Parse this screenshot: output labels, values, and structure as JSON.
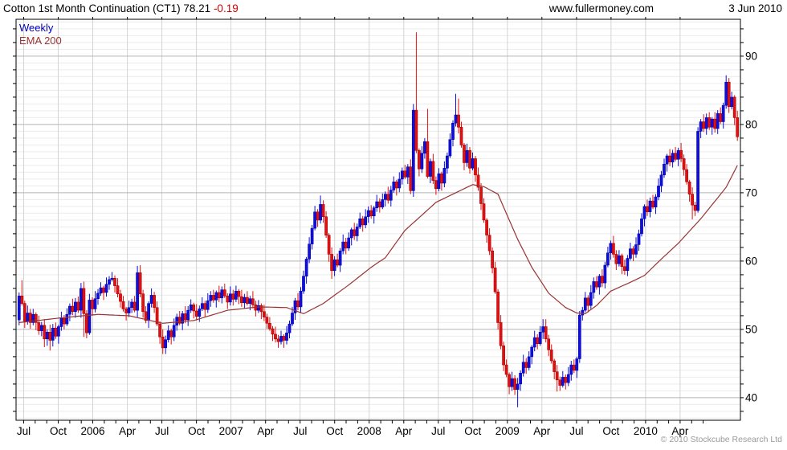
{
  "header": {
    "title_main": "Cotton 1st Month Continuation (CT1)",
    "last_price": "78.21",
    "change": "-0.19",
    "site": "www.fullermoney.com",
    "date": "3 Jun 2010"
  },
  "legend": {
    "series_label": "Weekly",
    "overlay_label": "EMA 200"
  },
  "footer": {
    "copyright": "© 2010 Stockcube Research Ltd"
  },
  "colors": {
    "up": "#0e0ee0",
    "up_stroke": "#000099",
    "down": "#e41010",
    "down_stroke": "#990000",
    "ema": "#993333",
    "grid_minor": "#ececec",
    "grid_major": "#b4b4b4",
    "grid_vert": "#d4d4d4",
    "axis": "#000000",
    "change_neg": "#cc0000",
    "copyright": "#9a9a9a"
  },
  "chart_data": {
    "type": "candlestick",
    "title": "Cotton 1st Month Continuation (CT1)",
    "interval": "Weekly",
    "overlay": "EMA 200",
    "start": "Jul 2005",
    "end": "Jun 2010",
    "ylim": [
      36.7,
      95.4
    ],
    "y_tick_labels": [
      40,
      50,
      60,
      70,
      80,
      90
    ],
    "y_minor_step": 1,
    "y_tick_step": 2,
    "months_total": 59,
    "x_ticks": [
      {
        "m": 0,
        "label": "Jul"
      },
      {
        "m": 3,
        "label": "Oct"
      },
      {
        "m": 6,
        "label": "2006"
      },
      {
        "m": 9,
        "label": "Apr"
      },
      {
        "m": 12,
        "label": "Jul"
      },
      {
        "m": 15,
        "label": "Oct"
      },
      {
        "m": 18,
        "label": "2007"
      },
      {
        "m": 21,
        "label": "Apr"
      },
      {
        "m": 24,
        "label": "Jul"
      },
      {
        "m": 27,
        "label": "Oct"
      },
      {
        "m": 30,
        "label": "2008"
      },
      {
        "m": 33,
        "label": "Apr"
      },
      {
        "m": 36,
        "label": "Jul"
      },
      {
        "m": 39,
        "label": "Oct"
      },
      {
        "m": 42,
        "label": "2009"
      },
      {
        "m": 45,
        "label": "Apr"
      },
      {
        "m": 48,
        "label": "Jul"
      },
      {
        "m": 51,
        "label": "Oct"
      },
      {
        "m": 54,
        "label": "2010"
      },
      {
        "m": 57,
        "label": "Apr"
      }
    ],
    "open_first": 51.4,
    "closes": [
      54.9,
      53.8,
      51.2,
      52.4,
      51.0,
      52.2,
      51.0,
      49.8,
      50.6,
      48.6,
      49.6,
      48.4,
      50.2,
      49.0,
      50.4,
      51.6,
      50.8,
      52.2,
      53.4,
      52.6,
      54.0,
      52.8,
      56.0,
      52.3,
      49.5,
      54.3,
      53.0,
      54.5,
      55.3,
      56.1,
      55.4,
      56.6,
      57.3,
      57.5,
      56.4,
      55.2,
      54.1,
      53.0,
      52.4,
      53.2,
      54.0,
      52.8,
      58.3,
      55.2,
      52.6,
      51.3,
      53.8,
      55.0,
      53.2,
      50.8,
      48.9,
      47.3,
      48.5,
      49.8,
      48.9,
      50.6,
      51.8,
      50.9,
      52.3,
      51.4,
      52.8,
      53.6,
      52.7,
      51.9,
      53.0,
      53.8,
      52.9,
      54.2,
      55.0,
      54.3,
      55.4,
      54.6,
      55.8,
      54.9,
      54.0,
      55.2,
      54.4,
      55.6,
      54.8,
      53.9,
      54.7,
      53.8,
      54.5,
      53.6,
      52.8,
      53.5,
      52.6,
      51.8,
      50.9,
      50.1,
      49.3,
      48.6,
      48.2,
      49.0,
      48.4,
      49.5,
      50.8,
      52.4,
      54.2,
      53.3,
      55.6,
      57.8,
      60.3,
      62.5,
      64.8,
      67.2,
      66.0,
      68.3,
      66.5,
      63.8,
      61.0,
      58.6,
      60.2,
      59.4,
      61.5,
      62.8,
      61.9,
      63.4,
      64.6,
      63.7,
      65.0,
      66.2,
      65.3,
      66.5,
      67.4,
      66.6,
      67.8,
      68.7,
      67.9,
      69.0,
      69.8,
      68.9,
      70.4,
      71.6,
      70.7,
      72.0,
      73.2,
      72.3,
      73.8,
      70.3,
      82.1,
      76.2,
      73.5,
      75.8,
      77.5,
      72.4,
      74.6,
      71.8,
      70.6,
      72.8,
      71.4,
      73.6,
      75.4,
      77.8,
      80.2,
      81.4,
      79.6,
      77.0,
      74.4,
      76.2,
      73.6,
      75.0,
      72.6,
      70.8,
      68.4,
      66.0,
      63.8,
      61.5,
      59.0,
      55.5,
      51.0,
      47.6,
      44.8,
      43.4,
      41.6,
      42.8,
      41.2,
      42.0,
      43.6,
      45.2,
      44.4,
      46.0,
      47.4,
      48.8,
      47.9,
      49.6,
      50.4,
      48.6,
      47.0,
      45.4,
      43.8,
      42.6,
      41.8,
      43.0,
      42.2,
      43.4,
      44.8,
      44.0,
      45.7,
      52.1,
      52.8,
      54.6,
      53.5,
      55.4,
      57.0,
      56.2,
      57.8,
      56.8,
      59.4,
      61.2,
      62.6,
      61.0,
      59.6,
      60.8,
      59.2,
      58.6,
      60.4,
      61.8,
      61.0,
      62.4,
      64.0,
      66.2,
      68.0,
      67.2,
      68.8,
      67.9,
      69.4,
      71.0,
      72.6,
      74.2,
      75.4,
      74.5,
      75.8,
      74.9,
      76.2,
      75.0,
      73.4,
      71.6,
      69.8,
      68.2,
      67.4,
      79.0,
      80.4,
      79.4,
      81.0,
      79.6,
      80.8,
      79.4,
      81.6,
      80.4,
      82.8,
      86.2,
      82.6,
      84.0,
      81.0,
      78.2
    ],
    "wick_pattern": [
      0.5,
      0.9,
      0.4,
      1.1,
      0.6,
      0.8,
      0.3,
      1.0
    ],
    "overrides": {
      "1": {
        "h": 57.2
      },
      "9": {
        "l": 47.4
      },
      "11": {
        "l": 46.9
      },
      "22": {
        "h": 56.8
      },
      "23": {
        "l": 48.9
      },
      "42": {
        "h": 59.3
      },
      "51": {
        "l": 46.4
      },
      "107": {
        "h": 69.6
      },
      "111": {
        "l": 57.4
      },
      "140": {
        "h": 83.0
      },
      "141": {
        "h": 93.5
      },
      "145": {
        "h": 82.3
      },
      "155": {
        "h": 84.5
      },
      "156": {
        "h": 83.8
      },
      "177": {
        "l": 38.6
      },
      "186": {
        "h": 51.5
      },
      "191": {
        "l": 40.9
      },
      "199": {
        "h": 52.7
      },
      "239": {
        "l": 66.1
      },
      "241": {
        "h": 79.6
      },
      "251": {
        "h": 87.2
      }
    },
    "ema200": [
      [
        0,
        51.0
      ],
      [
        15,
        51.7
      ],
      [
        28,
        52.2
      ],
      [
        39,
        52.0
      ],
      [
        51,
        50.9
      ],
      [
        62,
        51.3
      ],
      [
        74,
        52.8
      ],
      [
        85,
        53.3
      ],
      [
        95,
        53.2
      ],
      [
        101,
        52.3
      ],
      [
        108,
        53.8
      ],
      [
        117,
        56.5
      ],
      [
        125,
        59.1
      ],
      [
        130,
        60.5
      ],
      [
        137,
        64.5
      ],
      [
        148,
        68.6
      ],
      [
        157,
        70.4
      ],
      [
        161,
        71.2
      ],
      [
        165,
        70.9
      ],
      [
        170,
        69.8
      ],
      [
        177,
        63.2
      ],
      [
        182,
        59.1
      ],
      [
        188,
        55.3
      ],
      [
        194,
        53.2
      ],
      [
        198,
        52.4
      ],
      [
        201,
        52.3
      ],
      [
        205,
        53.5
      ],
      [
        210,
        55.6
      ],
      [
        217,
        56.9
      ],
      [
        222,
        57.9
      ],
      [
        228,
        60.3
      ],
      [
        234,
        62.6
      ],
      [
        242,
        66.2
      ],
      [
        251,
        70.8
      ],
      [
        255,
        74.0
      ]
    ]
  }
}
